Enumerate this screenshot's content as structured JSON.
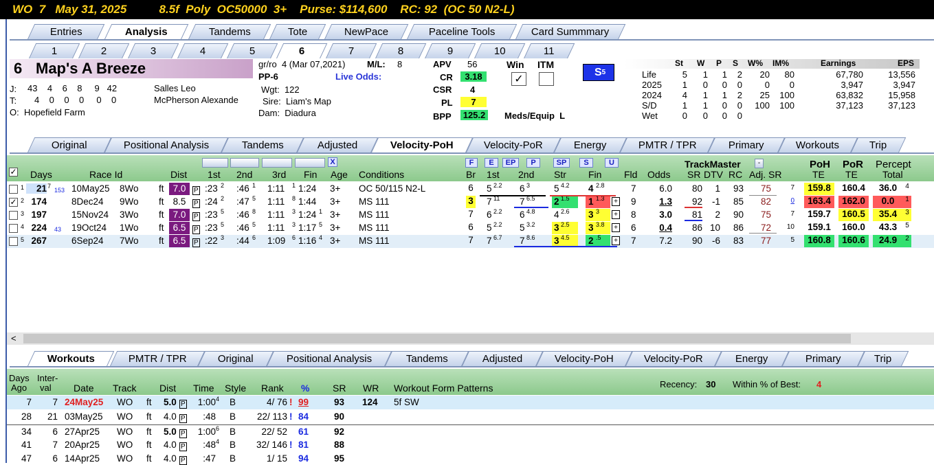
{
  "title": "WO  7   May 31, 2025          8.5f  Poly  OC50000  3+    Purse: $114,600    RC: 92  (OC 50 N2-L)",
  "main_tabs": [
    "Entries",
    "Analysis",
    "Tandems",
    "Tote",
    "NewPace",
    "Paceline Tools",
    "Card Summmary"
  ],
  "num_tabs": [
    "1",
    "2",
    "3",
    "4",
    "5",
    "6",
    "7",
    "8",
    "9",
    "10",
    "11"
  ],
  "horse": {
    "number": "6",
    "name": "Map's A Breeze",
    "jockey_label": "J:",
    "jockey_stats": "43    4    6    8     9   42",
    "jockey": "Salles Leo",
    "trainer_label": "T:",
    "trainer_stats": "4    0    0    0     0    0",
    "trainer": "McPherson Alexande",
    "owner": "O:  Hopefield Farm",
    "breed": "gr/ro  4 (Mar 07,2021)",
    "ml_label": "M/L:",
    "ml": "8",
    "pp": "PP-6",
    "live_odds": "Live Odds:",
    "wgt": "Wgt:  122",
    "sire": "Sire:  Liam's Map",
    "dam": "Dam:  Diadura"
  },
  "ratings": {
    "apv_l": "APV",
    "apv": "56",
    "cr_l": "CR",
    "cr": "3.18",
    "csr_l": "CSR",
    "csr": "4",
    "pl_l": "PL",
    "pl": "7",
    "bpp_l": "BPP",
    "bpp": "125.2",
    "win": "Win",
    "itm": "ITM",
    "meds": "Meds/Equip  L",
    "s5": "S"
  },
  "record": {
    "headers": [
      "St",
      "W",
      "P",
      "S",
      "W%",
      "IM%",
      "Earnings",
      "EPS"
    ],
    "rows": [
      [
        "Life",
        "5",
        "1",
        "1",
        "2",
        "20",
        "80",
        "67,780",
        "13,556"
      ],
      [
        "2025",
        "1",
        "0",
        "0",
        "0",
        "0",
        "0",
        "3,947",
        "3,947"
      ],
      [
        "2024",
        "4",
        "1",
        "1",
        "2",
        "25",
        "100",
        "63,832",
        "15,958"
      ],
      [
        "S/D",
        "1",
        "1",
        "0",
        "0",
        "100",
        "100",
        "37,123",
        "37,123"
      ],
      [
        "Wet",
        "0",
        "0",
        "0",
        "0",
        "",
        "",
        "",
        ""
      ]
    ]
  },
  "analysis_tabs": [
    "Original",
    "Positional Analysis",
    "Tandems",
    "Adjusted",
    "Velocity-PoH",
    "Velocity-PoR",
    "Energy",
    "PMTR / TPR",
    "Primary",
    "Workouts",
    "Trip"
  ],
  "grid_headers": {
    "days": "Days",
    "race": "Race Id",
    "dist": "Dist",
    "c1": "1st",
    "c2": "2nd",
    "c3": "3rd",
    "fin": "Fin",
    "age": "Age",
    "cond": "Conditions",
    "br": "Br",
    "p1": "1st",
    "p2": "2nd",
    "str": "Str",
    "pfin": "Fin",
    "fld": "Fld",
    "odds": "Odds",
    "tm": "TrackMaster",
    "sr": "SR",
    "dtv": "DTV",
    "rc": "RC",
    "adj": "Adj. SR",
    "poh": "PoH",
    "por": "PoR",
    "te1": "TE",
    "te2": "TE",
    "pct": "Percept",
    "total": "Total",
    "btnF": "F",
    "btnE": "E",
    "btnEP": "EP",
    "btnP": "P",
    "btnSP": "SP",
    "btnS": "S",
    "btnU": "U",
    "btnX": "X"
  },
  "races": [
    {
      "n": "1",
      "days": "21",
      "ds": "7",
      "ds2": "153",
      "date": "10May25",
      "trk": "8Wo",
      "sf": "ft",
      "dist": "7.0",
      "f1": ":23",
      "f1s": "2",
      "f2": ":46",
      "f2s": "1",
      "f3": "1:11",
      "f3s": "1",
      "fin": "1:24",
      "age": "3+",
      "cond": "OC 50/115 N2-L",
      "br": "6",
      "p1": "5",
      "p1s": "2.2",
      "p2": "6",
      "p2s": "3",
      "str": "5",
      "strs": "4.2",
      "pf": "4",
      "pfs": "2.8",
      "fld": "7",
      "odds": "6.0",
      "sr": "80",
      "dtv": "1",
      "rc": "93",
      "adj": "75",
      "adjs": "7",
      "poh": "159.8",
      "por": "160.4",
      "pct": "36.0",
      "pcts": "4"
    },
    {
      "n": "2",
      "days": "174",
      "ds": "",
      "ds2": "",
      "date": "8Dec24",
      "trk": "9Wo",
      "sf": "ft",
      "dist": "8.5",
      "f1": ":24",
      "f1s": "2",
      "f2": ":47",
      "f2s": "5",
      "f3": "1:11",
      "f3s": "8",
      "fin": "1:44",
      "age": "3+",
      "cond": "MS 111",
      "br": "3",
      "p1": "7",
      "p1s": "11",
      "p2": "7",
      "p2s": "6.5",
      "str": "2",
      "strs": "1.5",
      "pf": "1",
      "pfs": "1.3",
      "fld": "9",
      "odds": "1.3",
      "sr": "92",
      "dtv": "-1",
      "rc": "85",
      "adj": "82",
      "adjs": "0",
      "poh": "163.4",
      "por": "162.0",
      "pct": "0.0",
      "pcts": "1"
    },
    {
      "n": "3",
      "days": "197",
      "ds": "",
      "ds2": "",
      "date": "15Nov24",
      "trk": "3Wo",
      "sf": "ft",
      "dist": "7.0",
      "f1": ":23",
      "f1s": "5",
      "f2": ":46",
      "f2s": "8",
      "f3": "1:11",
      "f3s": "3",
      "fin": "1:24",
      "fins": "1",
      "age": "3+",
      "cond": "MS 111",
      "br": "7",
      "p1": "6",
      "p1s": "2.2",
      "p2": "6",
      "p2s": "4.8",
      "str": "4",
      "strs": "2.6",
      "pf": "3",
      "pfs": "3",
      "fld": "8",
      "odds": "3.0",
      "sr": "81",
      "dtv": "2",
      "rc": "90",
      "adj": "75",
      "adjs": "7",
      "poh": "159.7",
      "por": "160.5",
      "pct": "35.4",
      "pcts": "3"
    },
    {
      "n": "4",
      "days": "224",
      "ds": "",
      "ds2": "43",
      "date": "19Oct24",
      "trk": "1Wo",
      "sf": "ft",
      "dist": "6.5",
      "f1": ":23",
      "f1s": "5",
      "f2": ":46",
      "f2s": "5",
      "f3": "1:11",
      "f3s": "3",
      "fin": "1:17",
      "fins": "5",
      "age": "3+",
      "cond": "MS 111",
      "br": "6",
      "p1": "5",
      "p1s": "2.2",
      "p2": "5",
      "p2s": "3.2",
      "str": "3",
      "strs": "2.5",
      "pf": "3",
      "pfs": "3.8",
      "fld": "6",
      "odds": "0.4",
      "sr": "86",
      "dtv": "10",
      "rc": "86",
      "adj": "72",
      "adjs": "10",
      "poh": "159.1",
      "por": "160.0",
      "pct": "43.3",
      "pcts": "5"
    },
    {
      "n": "5",
      "days": "267",
      "ds": "",
      "ds2": "",
      "date": "6Sep24",
      "trk": "7Wo",
      "sf": "ft",
      "dist": "6.5",
      "f1": ":22",
      "f1s": "3",
      "f2": ":44",
      "f2s": "6",
      "f3": "1:09",
      "f3s": "6",
      "fin": "1:16",
      "fins": "4",
      "age": "3+",
      "cond": "MS 111",
      "br": "7",
      "p1": "7",
      "p1s": "6.7",
      "p2": "7",
      "p2s": "8.6",
      "str": "3",
      "strs": "4.5",
      "pf": "2",
      "pfs": ".5",
      "fld": "7",
      "odds": "7.2",
      "sr": "90",
      "dtv": "-6",
      "rc": "83",
      "adj": "77",
      "adjs": "5",
      "poh": "160.8",
      "por": "160.6",
      "pct": "24.9",
      "pcts": "2"
    }
  ],
  "bottom_tabs": [
    "Workouts",
    "PMTR / TPR",
    "Original",
    "Positional Analysis",
    "Tandems",
    "Adjusted",
    "Velocity-PoH",
    "Velocity-PoR",
    "Energy",
    "Primary",
    "Trip"
  ],
  "wk_headers": {
    "days": "Days",
    "ago": "Ago",
    "inter": "Inter-",
    "val": "val",
    "date": "Date",
    "track": "Track",
    "dist": "Dist",
    "time": "Time",
    "style": "Style",
    "rank": "Rank",
    "pct": "%",
    "sr": "SR",
    "wr": "WR",
    "wfp": "Workout Form Patterns",
    "recency_l": "Recency:",
    "recency": "30",
    "within_l": "Within % of Best:",
    "within": "4"
  },
  "workouts": [
    {
      "ago": "7",
      "int": "7",
      "date": "24May25",
      "trk": "WO",
      "sf": "ft",
      "dist": "5.0",
      "time": "1:00",
      "ts": "4",
      "style": "B",
      "rank": "4/ 76",
      "bang": "!",
      "pct": "99",
      "sr": "93",
      "wr": "124",
      "wfp": "5f SW"
    },
    {
      "ago": "28",
      "int": "21",
      "date": "03May25",
      "trk": "WO",
      "sf": "ft",
      "dist": "4.0",
      "time": ":48",
      "ts": "",
      "style": "B",
      "rank": "22/ 113",
      "bang": "!",
      "pct": "84",
      "sr": "90",
      "wr": "",
      "wfp": ""
    },
    {
      "ago": "34",
      "int": "6",
      "date": "27Apr25",
      "trk": "WO",
      "sf": "ft",
      "dist": "5.0",
      "time": "1:00",
      "ts": "6",
      "style": "B",
      "rank": "22/ 52",
      "bang": "",
      "pct": "61",
      "sr": "92",
      "wr": "",
      "wfp": ""
    },
    {
      "ago": "41",
      "int": "7",
      "date": "20Apr25",
      "trk": "WO",
      "sf": "ft",
      "dist": "4.0",
      "time": ":48",
      "ts": "4",
      "style": "B",
      "rank": "32/ 146",
      "bang": "!",
      "pct": "81",
      "sr": "88",
      "wr": "",
      "wfp": ""
    },
    {
      "ago": "47",
      "int": "6",
      "date": "14Apr25",
      "trk": "WO",
      "sf": "ft",
      "dist": "4.0",
      "time": ":47",
      "ts": "",
      "style": "B",
      "rank": "1/ 15",
      "bang": "",
      "pct": "94",
      "sr": "95",
      "wr": "",
      "wfp": ""
    }
  ],
  "colors": {
    "title_bg": "#000000",
    "title_fg": "#ffd21e",
    "header_green": "#8cc98c",
    "highlight_yellow": "#ffff33",
    "highlight_green": "#33e070",
    "highlight_red": "#ff5a5a",
    "dist_purple": "#7a1a7f",
    "tab_blue": "#c5d3ea"
  }
}
